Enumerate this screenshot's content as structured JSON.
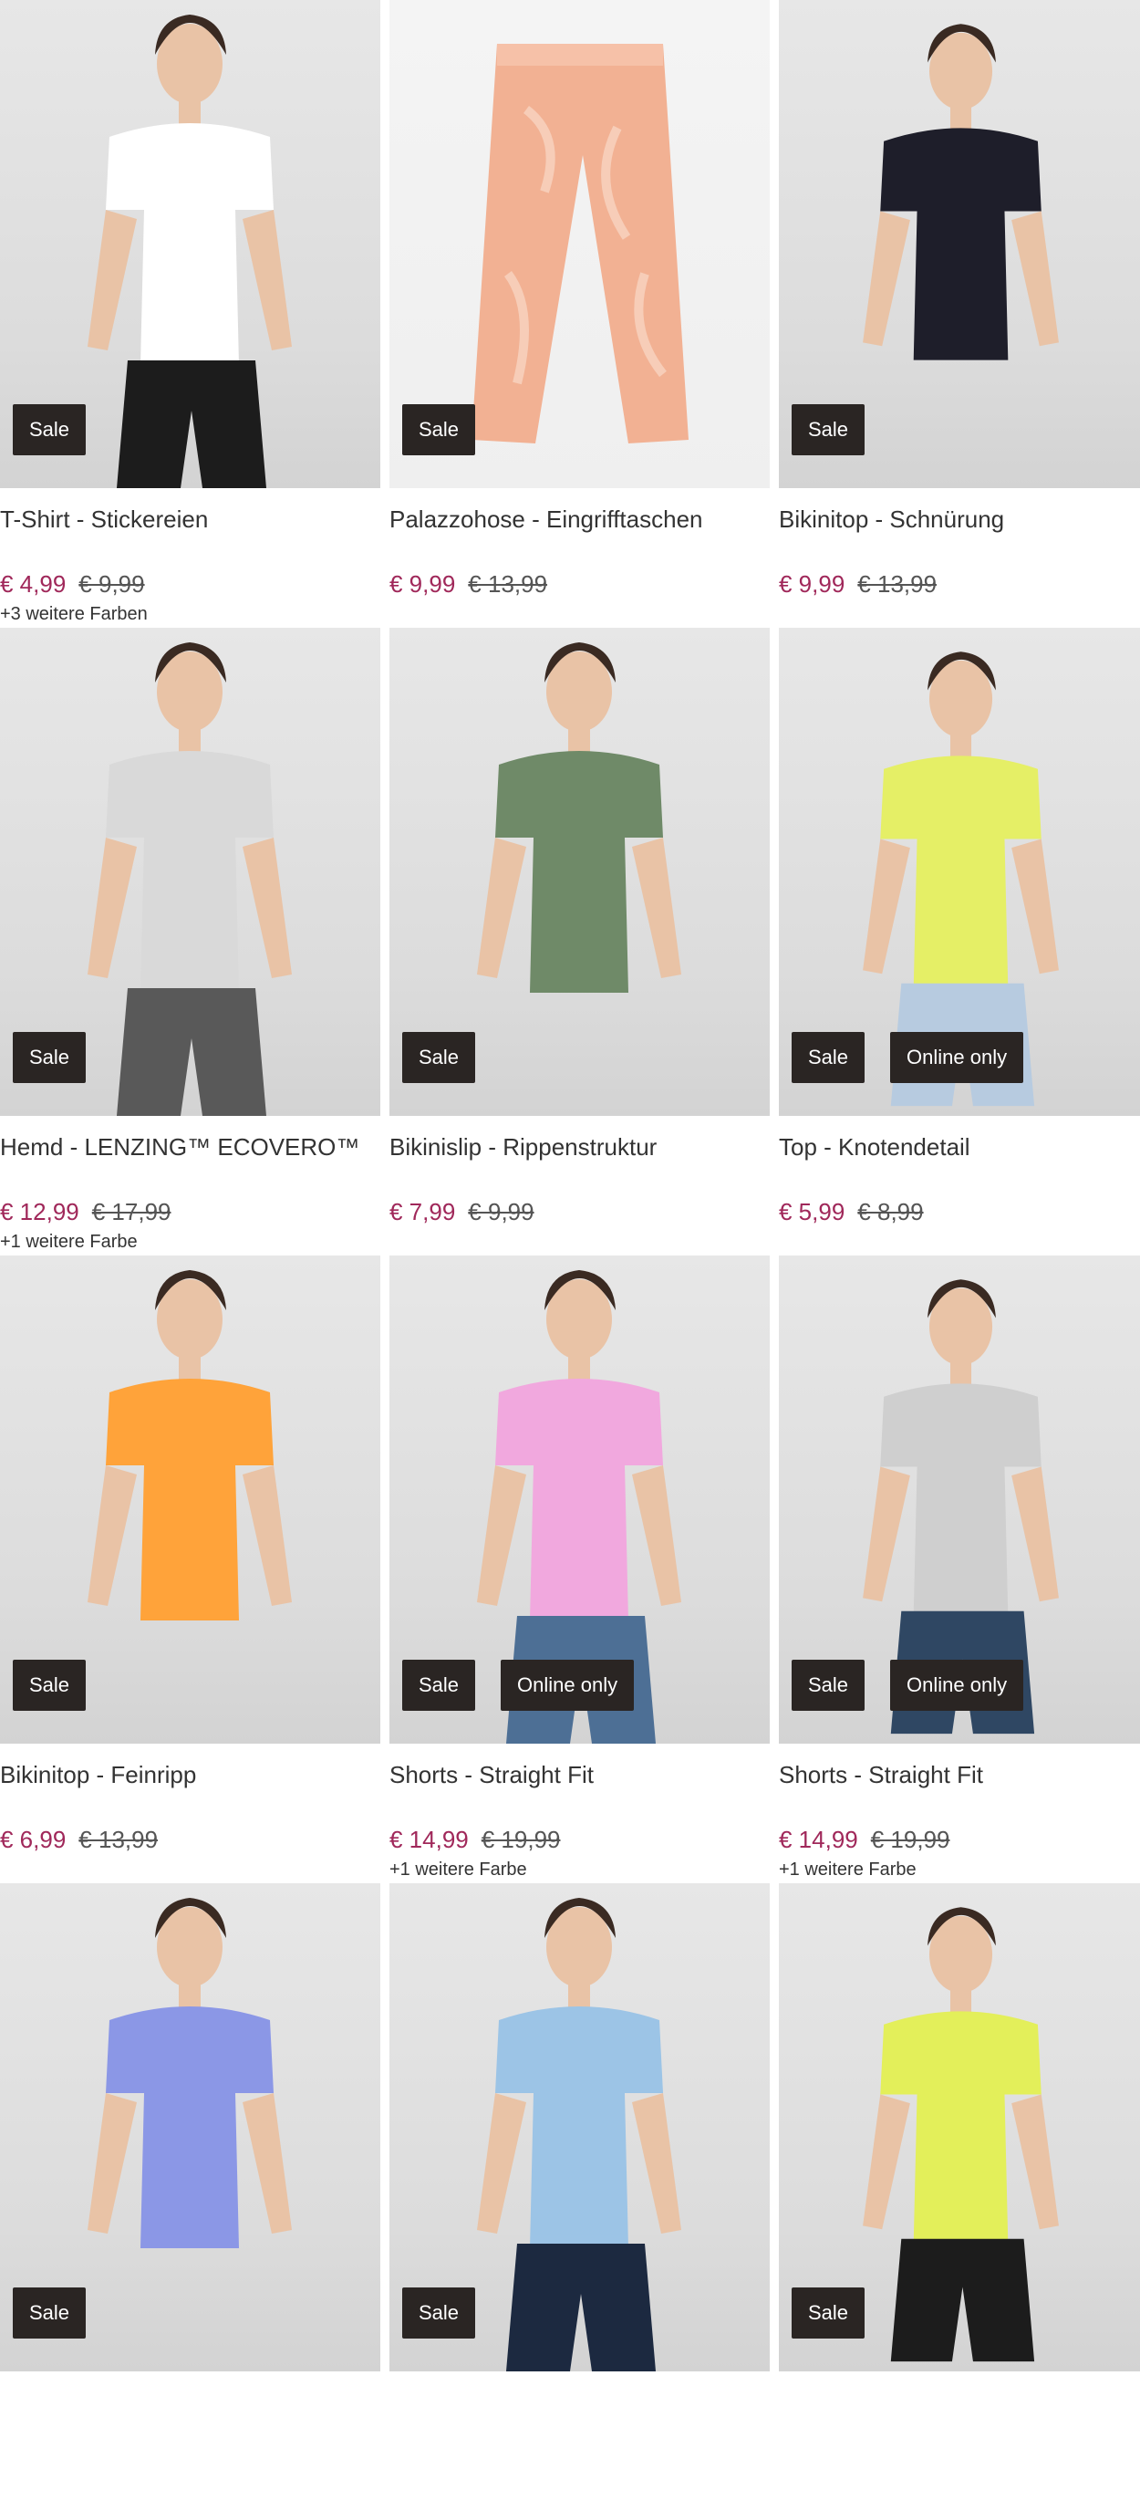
{
  "products": [
    {
      "title": "T-Shirt - Stickereien",
      "price": "€ 4,99",
      "old_price": "€ 9,99",
      "badges": [
        "Sale"
      ],
      "colors_note": "+3 weitere Farben",
      "bg": "grey",
      "garment_color": "#ffffff",
      "lower_color": "#1c1c1c"
    },
    {
      "title": "Palazzohose - Eingrifftaschen",
      "price": "€ 9,99",
      "old_price": "€ 13,99",
      "badges": [
        "Sale"
      ],
      "colors_note": "",
      "bg": "white",
      "garment_color": "#f2b193",
      "lower_color": ""
    },
    {
      "title": "Bikinitop - Schnürung",
      "price": "€ 9,99",
      "old_price": "€ 13,99",
      "badges": [
        "Sale"
      ],
      "colors_note": "",
      "bg": "grey",
      "garment_color": "#1e1e2a",
      "lower_color": ""
    },
    {
      "title": "Hemd - LENZING™ ECOVERO™",
      "price": "€ 12,99",
      "old_price": "€ 17,99",
      "badges": [
        "Sale"
      ],
      "colors_note": "+1 weitere Farbe",
      "bg": "grey",
      "garment_color": "#d9d9d9",
      "lower_color": "#595959"
    },
    {
      "title": "Bikinislip - Rippenstruktur",
      "price": "€ 7,99",
      "old_price": "€ 9,99",
      "badges": [
        "Sale"
      ],
      "colors_note": "",
      "bg": "grey",
      "garment_color": "#6f8a68",
      "lower_color": ""
    },
    {
      "title": "Top - Knotendetail",
      "price": "€ 5,99",
      "old_price": "€ 8,99",
      "badges": [
        "Sale",
        "Online only"
      ],
      "colors_note": "",
      "bg": "grey",
      "garment_color": "#e5ef66",
      "lower_color": "#b7cbe0"
    },
    {
      "title": "Bikinitop - Feinripp",
      "price": "€ 6,99",
      "old_price": "€ 13,99",
      "badges": [
        "Sale"
      ],
      "colors_note": "",
      "bg": "grey",
      "garment_color": "#ffa33a",
      "lower_color": ""
    },
    {
      "title": "Shorts - Straight Fit",
      "price": "€ 14,99",
      "old_price": "€ 19,99",
      "badges": [
        "Sale",
        "Online only"
      ],
      "colors_note": "+1 weitere Farbe",
      "bg": "grey",
      "garment_color": "#f1a8de",
      "lower_color": "#4d6f95"
    },
    {
      "title": "Shorts - Straight Fit",
      "price": "€ 14,99",
      "old_price": "€ 19,99",
      "badges": [
        "Sale",
        "Online only"
      ],
      "colors_note": "+1 weitere Farbe",
      "bg": "grey",
      "garment_color": "#cfcfcf",
      "lower_color": "#2f4763"
    },
    {
      "title": "",
      "price": "",
      "old_price": "",
      "badges": [
        "Sale"
      ],
      "colors_note": "",
      "bg": "grey",
      "garment_color": "#8b97e6",
      "lower_color": ""
    },
    {
      "title": "",
      "price": "",
      "old_price": "",
      "badges": [
        "Sale"
      ],
      "colors_note": "",
      "bg": "grey",
      "garment_color": "#9cc4e6",
      "lower_color": "#1c2940"
    },
    {
      "title": "",
      "price": "",
      "old_price": "",
      "badges": [
        "Sale"
      ],
      "colors_note": "",
      "bg": "grey",
      "garment_color": "#e3ef5a",
      "lower_color": "#1c1c1c"
    }
  ]
}
